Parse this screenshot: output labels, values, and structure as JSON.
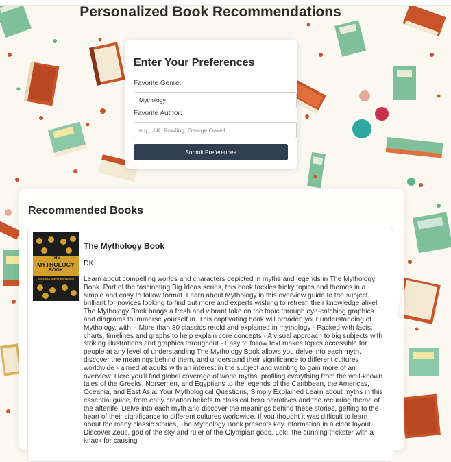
{
  "page": {
    "title": "Personalized Book Recommendations"
  },
  "preferences": {
    "heading": "Enter Your Preferences",
    "genre_label": "Favorite Genre:",
    "genre_value": "Mythology",
    "author_label": "Favorite Author:",
    "author_value": "",
    "author_placeholder": "e.g., J.K. Rowling, George Orwell",
    "submit_label": "Submit Preferences"
  },
  "recommendations": {
    "heading": "Recommended Books",
    "books": [
      {
        "title": "The Mythology Book",
        "author": "DK",
        "cover": {
          "line1": "THE",
          "line2": "MYTHOLOGY",
          "line3": "BOOK",
          "tagline": "BIG IDEAS SIMPLY EXPLAINED"
        },
        "description": "Learn about compelling worlds and characters depicted in myths and legends in The Mythology Book. Part of the fascinating Big Ideas series, this book tackles tricky topics and themes in a simple and easy to follow format. Learn about Mythology in this overview guide to the subject, brilliant for novices looking to find out more and experts wishing to refresh their knowledge alike! The Mythology Book brings a fresh and vibrant take on the topic through eye-catching graphics and diagrams to immerse yourself in. This captivating book will broaden your understanding of Mythology, with: - More than 80 classics retold and explained in mythology - Packed with facts, charts, timelines and graphs to help explain core concepts - A visual approach to big subjects with striking illustrations and graphics throughout - Easy to follow text makes topics accessible for people at any level of understanding The Mythology Book allows you delve into each myth, discover the meanings behind them, and understand their significance to different cultures worldwide - aimed at adults with an interest in the subject and wanting to gain more of an overview. Here you'll find global coverage of world myths, profiling everything from the well-known tales of the Greeks, Norsemen, and Egyptians to the legends of the Caribbean, the Americas, Oceania, and East Asia. Your Mythological Questions, Simply Explained Learn about myths in this essential guide, from early creation beliefs to classical hero narratives and the recurring theme of the afterlife. Delve into each myth and discover the meanings behind these stories, getting to the heart of their significance to different cultures worldwide. If you thought it was difficult to learn about the many classic stories, The Mythology Book presents key information in a clear layout. Discover Zeus, god of the sky and ruler of the Olympian gods, Loki, the cunning trickster with a knack for causing"
      }
    ]
  },
  "colors": {
    "button": "#2f3e51",
    "background": "#fbf7f1",
    "cover_accent": "#d4a02d"
  }
}
